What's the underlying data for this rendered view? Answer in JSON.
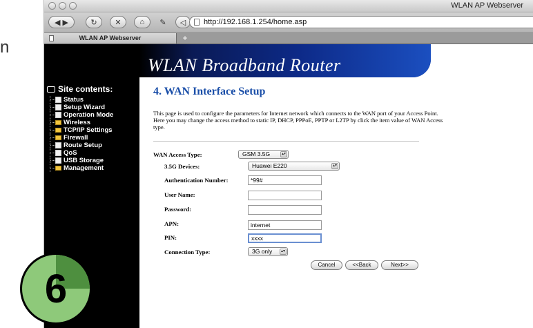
{
  "side_text": "n",
  "window": {
    "title": "WLAN AP Webserver",
    "url": "http://192.168.1.254/home.asp",
    "tab_label": "WLAN AP Webserver",
    "new_tab": "+"
  },
  "banner": {
    "title": "WLAN Broadband Router"
  },
  "sidebar": {
    "heading": "Site contents:",
    "items": [
      {
        "label": "Status",
        "icon": "doc"
      },
      {
        "label": "Setup Wizard",
        "icon": "doc"
      },
      {
        "label": "Operation Mode",
        "icon": "doc"
      },
      {
        "label": "Wireless",
        "icon": "folder"
      },
      {
        "label": "TCP/IP Settings",
        "icon": "folder"
      },
      {
        "label": "Firewall",
        "icon": "folder"
      },
      {
        "label": "Route Setup",
        "icon": "doc"
      },
      {
        "label": "QoS",
        "icon": "doc"
      },
      {
        "label": "USB Storage",
        "icon": "doc"
      },
      {
        "label": "Management",
        "icon": "folder"
      }
    ]
  },
  "main": {
    "title": "4. WAN Interface Setup",
    "description": "This page is used to configure the parameters for Internet network which connects to the WAN port of your Access Point. Here you may change the access method to static IP, DHCP, PPPoE, PPTP or L2TP by click the item value of WAN Access type.",
    "fields": {
      "wan_access_type": {
        "label": "WAN Access Type:",
        "value": "GSM 3.5G"
      },
      "devices": {
        "label": "3.5G Devices:",
        "value": "Huawei E220"
      },
      "auth_number": {
        "label": "Authentication Number:",
        "value": "*99#"
      },
      "user_name": {
        "label": "User Name:",
        "value": ""
      },
      "password": {
        "label": "Password:",
        "value": ""
      },
      "apn": {
        "label": "APN:",
        "value": "internet"
      },
      "pin": {
        "label": "PIN:",
        "value": "xxxx"
      },
      "connection_type": {
        "label": "Connection Type:",
        "value": "3G only"
      }
    },
    "buttons": {
      "cancel": "Cancel",
      "back": "<<Back",
      "next": "Next>>"
    }
  },
  "badge": {
    "number": "6"
  },
  "colors": {
    "banner_blue": "#0d2a88",
    "title_blue": "#1a4ea8",
    "badge_light": "#8ec97a",
    "badge_dark": "#4e8f3f"
  }
}
